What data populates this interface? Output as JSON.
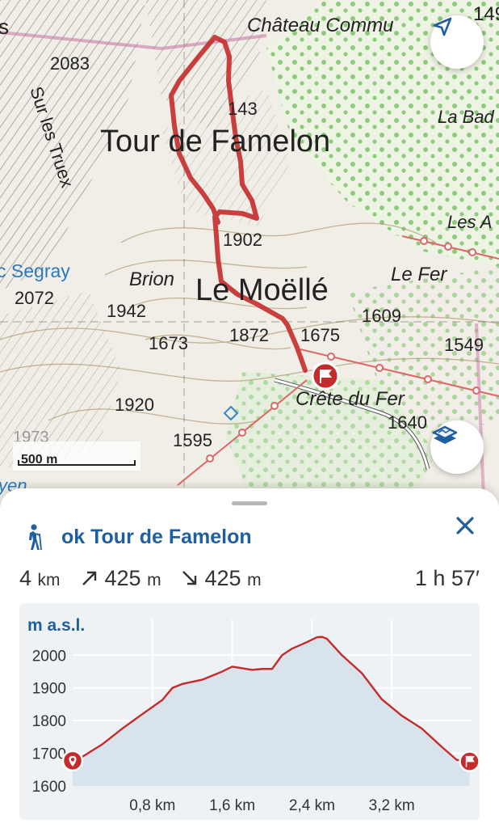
{
  "map": {
    "labels": [
      {
        "id": "s-edge",
        "text": "s"
      },
      {
        "id": "chateau",
        "text": "Château Commu"
      },
      {
        "id": "num-149",
        "text": "149"
      },
      {
        "id": "alt-2083",
        "text": "2083"
      },
      {
        "id": "alt-2143",
        "text": "143"
      },
      {
        "id": "la-bad",
        "text": "La Bad"
      },
      {
        "id": "tour-famelon",
        "text": "Tour de Famelon"
      },
      {
        "id": "sur-les-truex",
        "text": "Sur les Truex"
      },
      {
        "id": "les-a",
        "text": "Les A"
      },
      {
        "id": "alt-1902",
        "text": "1902"
      },
      {
        "id": "segray",
        "text": "c Segray"
      },
      {
        "id": "brion",
        "text": "Brion"
      },
      {
        "id": "le-moelle",
        "text": "Le Moëllé"
      },
      {
        "id": "le-fer",
        "text": "Le Fer"
      },
      {
        "id": "alt-2072",
        "text": "2072"
      },
      {
        "id": "alt-1942",
        "text": "1942"
      },
      {
        "id": "alt-1609",
        "text": "1609"
      },
      {
        "id": "alt-1872",
        "text": "1872"
      },
      {
        "id": "alt-1675",
        "text": "1675"
      },
      {
        "id": "alt-1673",
        "text": "1673"
      },
      {
        "id": "alt-1549",
        "text": "1549"
      },
      {
        "id": "crete-du-fer",
        "text": "Crête du Fer"
      },
      {
        "id": "alt-1920",
        "text": "1920"
      },
      {
        "id": "alt-1640",
        "text": "1640"
      },
      {
        "id": "alt-1595",
        "text": "1595"
      },
      {
        "id": "alt-1973",
        "text": "1973"
      },
      {
        "id": "yen",
        "text": "yen"
      }
    ],
    "scale_label": "500 m",
    "locate_icon": "navigation-arrow-icon",
    "layers_icon": "map-layers-icon",
    "route_color": "#c42b2b",
    "marker_color": "#c42b2b"
  },
  "sheet": {
    "activity_icon": "hiker-icon",
    "title": "ok Tour de Famelon",
    "close_icon": "close-icon",
    "stats": {
      "distance": "4",
      "distance_unit": "km",
      "ascent": "425",
      "ascent_unit": "m",
      "descent": "425",
      "descent_unit": "m",
      "duration": "1 h 57′"
    }
  },
  "chart_data": {
    "type": "area",
    "title": "",
    "xlabel": "",
    "ylabel": "m a.s.l.",
    "xlim": [
      0,
      4
    ],
    "ylim": [
      1600,
      2060
    ],
    "x_ticks": [
      {
        "v": 0.8,
        "label": "0,8 km"
      },
      {
        "v": 1.6,
        "label": "1,6 km"
      },
      {
        "v": 2.4,
        "label": "2,4 km"
      },
      {
        "v": 3.2,
        "label": "3,2 km"
      }
    ],
    "y_ticks": [
      {
        "v": 1600,
        "label": "1600"
      },
      {
        "v": 1700,
        "label": "1700"
      },
      {
        "v": 1800,
        "label": "1800"
      },
      {
        "v": 1900,
        "label": "1900"
      },
      {
        "v": 2000,
        "label": "2000"
      }
    ],
    "x": [
      0,
      0.1,
      0.3,
      0.5,
      0.7,
      0.9,
      1.0,
      1.1,
      1.3,
      1.5,
      1.6,
      1.7,
      1.8,
      1.9,
      2.0,
      2.1,
      2.2,
      2.35,
      2.45,
      2.5,
      2.55,
      2.7,
      2.9,
      3.1,
      3.3,
      3.5,
      3.7,
      3.85,
      3.98
    ],
    "y": [
      1677,
      1690,
      1728,
      1776,
      1820,
      1863,
      1900,
      1912,
      1925,
      1950,
      1965,
      1960,
      1955,
      1958,
      1958,
      2000,
      2020,
      2040,
      2055,
      2056,
      2050,
      2000,
      1945,
      1865,
      1815,
      1776,
      1720,
      1680,
      1675
    ],
    "line_color": "#c42b2b",
    "fill_color": "#d8e3ec",
    "grid": true
  }
}
